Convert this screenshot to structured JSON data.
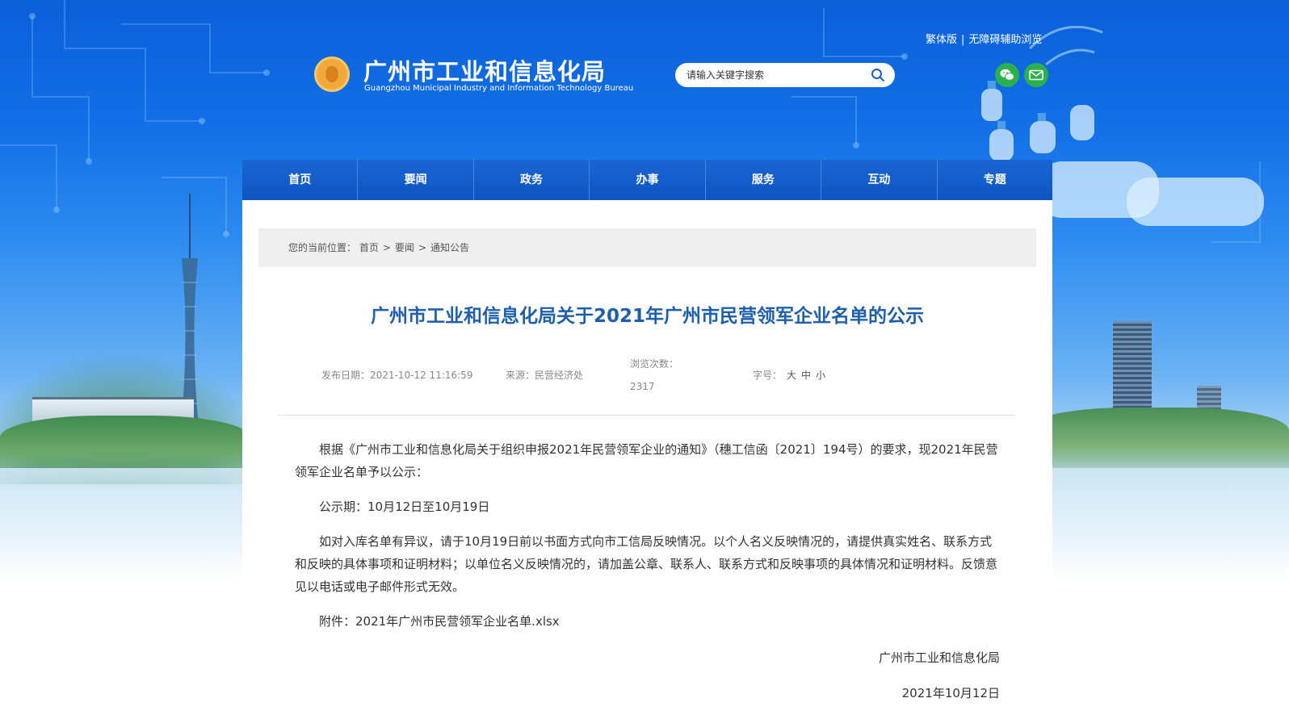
{
  "header": {
    "org_name_cn": "广州市工业和信息化局",
    "org_name_en": "Guangzhou Municipal Industry and Information Technology Bureau",
    "link_traditional": "繁体版",
    "link_separator": "|",
    "link_accessibility": "无障碍辅助浏览",
    "search_placeholder": "请输入关键字搜索",
    "icons": {
      "search": "search-icon",
      "wechat": "wechat-icon",
      "mail": "mail-icon"
    }
  },
  "nav": {
    "items": [
      "首页",
      "要闻",
      "政务",
      "办事",
      "服务",
      "互动",
      "专题"
    ]
  },
  "breadcrumb": {
    "prefix": "您的当前位置：",
    "items": [
      "首页",
      "要闻",
      "通知公告"
    ],
    "separator": ">"
  },
  "article": {
    "title": "广州市工业和信息化局关于2021年广州市民营领军企业名单的公示",
    "date": "发布日期：2021-10-12 11:16:59",
    "source": "来源：民营经济处",
    "views_label": "浏览次数：",
    "views_value": "2317",
    "fontsize_label": "字号：",
    "fontsize_large": "大",
    "fontsize_medium": "中",
    "fontsize_small": "小",
    "paragraphs": [
      "根据《广州市工业和信息化局关于组织申报2021年民营领军企业的通知》（穗工信函〔2021〕194号）的要求，现2021年民营领军企业名单予以公示：",
      "公示期：10月12日至10月19日",
      "如对入库名单有异议，请于10月19日前以书面方式向市工信局反映情况。以个人名义反映情况的，请提供真实姓名、联系方式和反映的具体事项和证明材料；以单位名义反映情况的，请加盖公章、联系人、联系方式和反映事项的具体情况和证明材料。反馈意见以电话或电子邮件形式无效。",
      "附件：2021年广州市民营领军企业名单.xlsx"
    ],
    "signature_org": "广州市工业和信息化局",
    "signature_date": "2021年10月12日"
  },
  "colors": {
    "nav_bg": "#1565d0",
    "title": "#1d5fae",
    "social_green": "#2ab04c"
  }
}
